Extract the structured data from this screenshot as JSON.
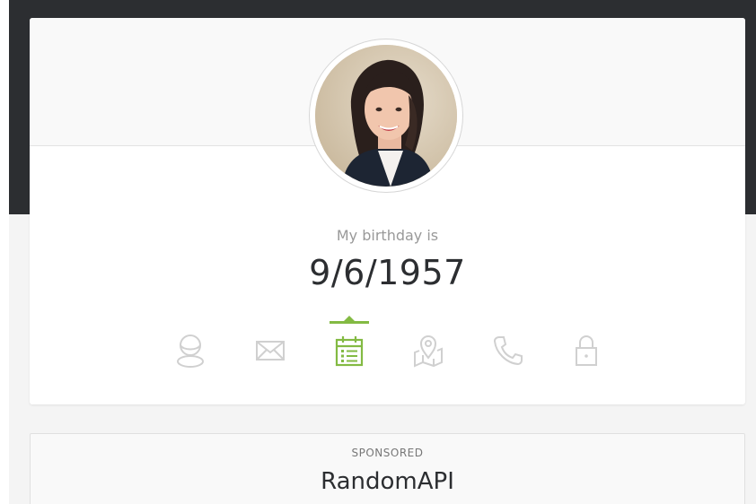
{
  "profile": {
    "info_title": "My birthday is",
    "info_value": "9/6/1957",
    "active_icon": "calendar-icon"
  },
  "icons": [
    {
      "name": "user-icon",
      "label": "Name"
    },
    {
      "name": "mail-icon",
      "label": "Email"
    },
    {
      "name": "calendar-icon",
      "label": "Birthday"
    },
    {
      "name": "map-icon",
      "label": "Address"
    },
    {
      "name": "phone-icon",
      "label": "Phone"
    },
    {
      "name": "lock-icon",
      "label": "Password"
    }
  ],
  "sponsored": {
    "label": "SPONSORED",
    "name": "RandomAPI"
  },
  "colors": {
    "accent": "#83ba43",
    "icon_inactive": "#d0d0d0",
    "header_dark": "#2c2e31",
    "text_muted": "#999999",
    "text_dark": "#2c2e31"
  }
}
